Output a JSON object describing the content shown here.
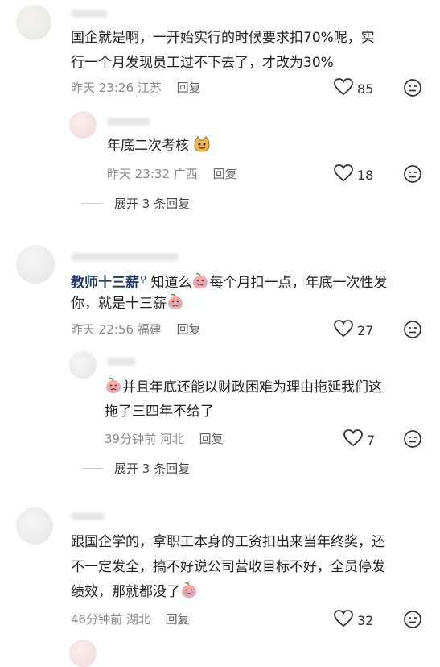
{
  "comments": [
    {
      "text_lines": [
        "国企就是啊，一开始实行的时候要求扣70%呢，实",
        "行一个月发现员工过不下去了，才改为30%"
      ],
      "time": "昨天 23:26",
      "location": "江苏",
      "reply_label": "回复",
      "likes": "85"
    },
    {
      "text": "年底二次考核",
      "emoji": "cat-face-emoji",
      "time": "昨天 23:32",
      "location": "广西",
      "reply_label": "回复",
      "likes": "18"
    },
    {
      "author": "教师十三薪",
      "line1": "知道么",
      "line1b": "每个月扣一点，年底一次性发",
      "line2": "你，就是十三薪",
      "time": "昨天 22:56",
      "location": "福建",
      "reply_label": "回复",
      "likes": "27"
    },
    {
      "line1": "并且年底还能以财政困难为理由拖延我们这",
      "line2": "拖了三四年不给了",
      "time": "39分钟前",
      "location": "河北",
      "reply_label": "回复",
      "likes": "7"
    },
    {
      "text_lines": [
        "跟国企学的，拿职工本身的工资扣出来当年终奖，还",
        "不一定发全，搞不好说公司营收目标不好，全员停发",
        "绩效，那就都没了"
      ],
      "time": "46分钟前",
      "location": "湖北",
      "reply_label": "回复",
      "likes": "32"
    }
  ],
  "expand_replies": [
    "展开 3 条回复",
    "展开 3 条回复"
  ],
  "icons": {
    "like": "heart-outline-icon",
    "dislike": "dislike-face-icon",
    "crying": "crying-peach-emoji"
  }
}
